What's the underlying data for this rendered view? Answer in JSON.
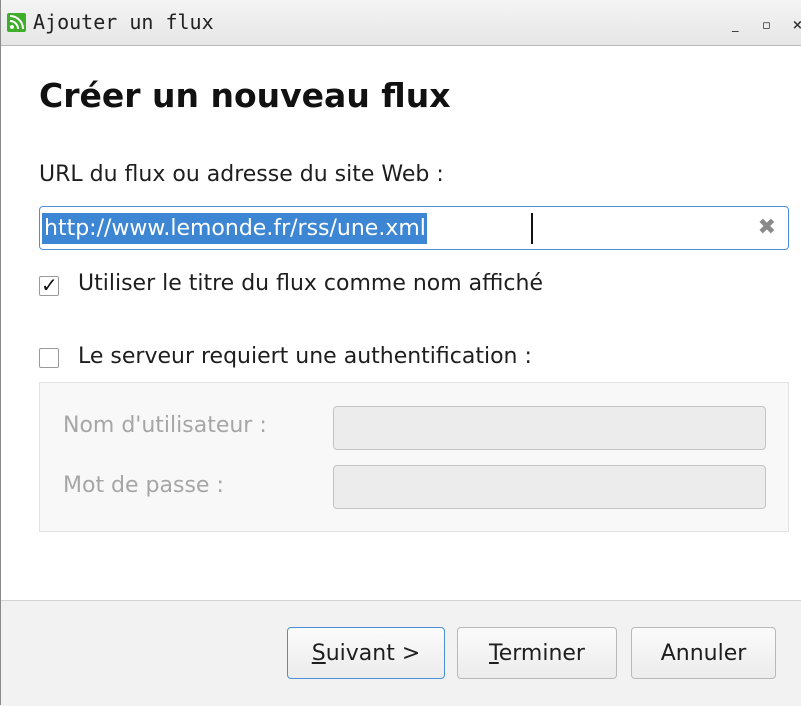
{
  "window": {
    "title": "Ajouter un flux",
    "app_icon": "rss-feed-icon",
    "controls": {
      "minimize": "_",
      "maximize": "▫",
      "close": "×"
    }
  },
  "heading": "Créer un nouveau flux",
  "url": {
    "label": "URL du flux ou adresse du site Web :",
    "value": "http://www.lemonde.fr/rss/une.xml",
    "clear_icon": "clear-icon"
  },
  "use_feed_title": {
    "label": "Utiliser le titre du flux comme nom affiché",
    "checked": true
  },
  "auth": {
    "label": "Le serveur requiert une authentification :",
    "checked": false,
    "username_label": "Nom d'utilisateur :",
    "password_label": "Mot de passe :"
  },
  "buttons": {
    "next": {
      "mnemonic": "S",
      "rest": "uivant >"
    },
    "finish": {
      "mnemonic": "T",
      "rest": "erminer"
    },
    "cancel": "Annuler"
  },
  "colors": {
    "accent": "#4a90d9",
    "selection": "#3d86d3",
    "rss_icon": "#3fae2a"
  }
}
